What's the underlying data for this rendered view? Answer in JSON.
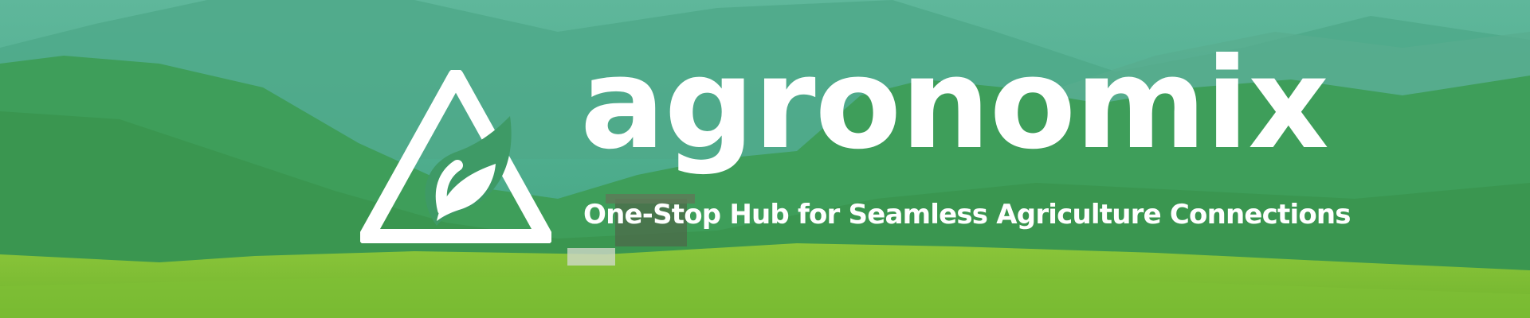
{
  "banner": {
    "brand_name": "agronomix",
    "tagline": "One-Stop Hub for Seamless Agriculture Connections",
    "logo_icon": "leaf-in-triangle-icon",
    "text_color": "#ffffff",
    "overlay_color": "#3a9a7a"
  }
}
